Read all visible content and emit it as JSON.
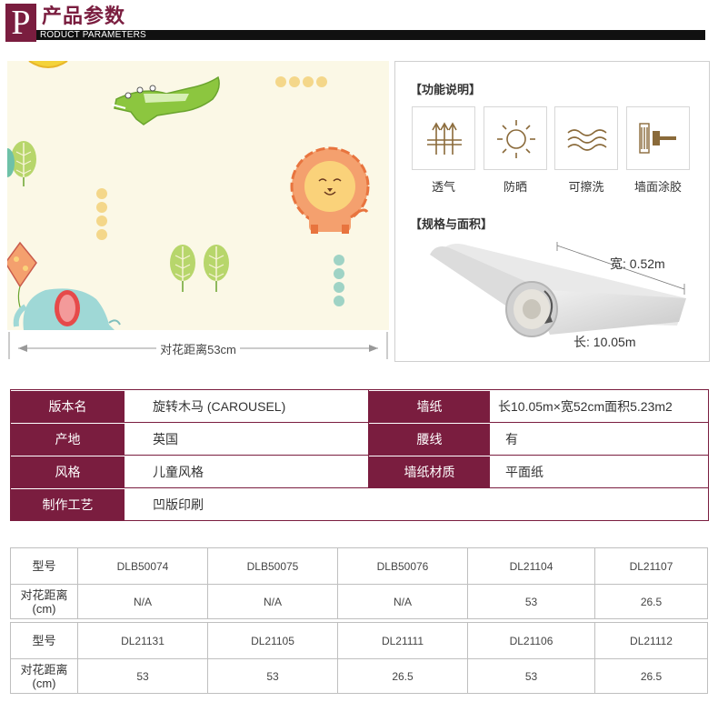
{
  "header": {
    "logo_letter": "P",
    "title": "产品参数",
    "subtitle": "RODUCT PARAMETERS"
  },
  "pattern": {
    "repeat_label": "对花距离53cm"
  },
  "features": {
    "section_title": "【功能说明】",
    "items": [
      {
        "icon": "breathable-icon",
        "label": "透气"
      },
      {
        "icon": "sun-icon",
        "label": "防晒"
      },
      {
        "icon": "wave-icon",
        "label": "可擦洗"
      },
      {
        "icon": "paste-brush-icon",
        "label": "墙面涂胶"
      }
    ]
  },
  "dimensions": {
    "section_title": "【规格与面积】",
    "width": "宽: 0.52m",
    "length": "长: 10.05m"
  },
  "spec": {
    "rows": [
      {
        "label1": "版本名",
        "value1": "旋转木马 (CAROUSEL)",
        "label2": "墙纸",
        "value2": "长10.05m×宽52cm面积5.23m2"
      },
      {
        "label1": "产地",
        "value1": "英国",
        "label2": "腰线",
        "value2": "有"
      },
      {
        "label1": "风格",
        "value1": "儿童风格",
        "label2": "墙纸材质",
        "value2": "平面纸"
      },
      {
        "label1": "制作工艺",
        "value1": "凹版印刷"
      }
    ]
  },
  "models": [
    {
      "model_label": "型号",
      "distance_label": "对花距离\n(cm)",
      "codes": [
        "DLB50074",
        "DLB50075",
        "DLB50076",
        "DL21104",
        "DL21107"
      ],
      "distances": [
        "N/A",
        "N/A",
        "N/A",
        "53",
        "26.5"
      ]
    },
    {
      "model_label": "型号",
      "distance_label": "对花距离\n(cm)",
      "codes": [
        "DL21131",
        "DL21105",
        "DL21111",
        "DL21106",
        "DL21112"
      ],
      "distances": [
        "53",
        "53",
        "26.5",
        "53",
        "26.5"
      ]
    }
  ],
  "colors": {
    "brand": "#7a1d3f",
    "pattern_bg": "#fbf8e6"
  }
}
